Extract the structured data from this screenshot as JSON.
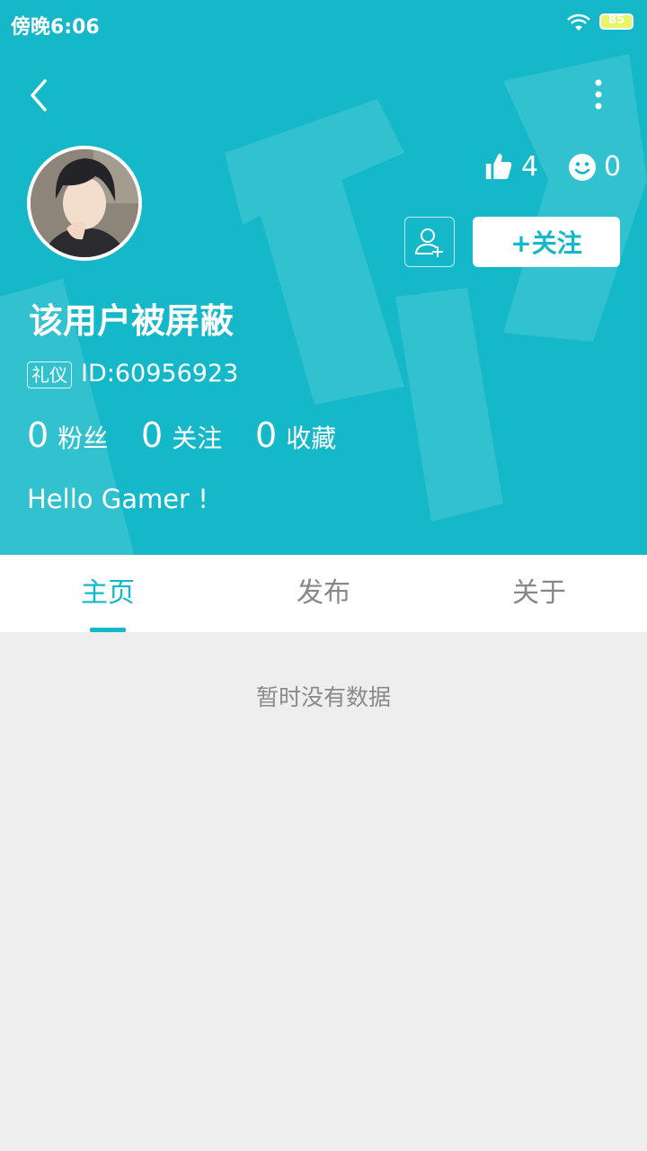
{
  "status_bar": {
    "time": "傍晚6:06",
    "battery": "85"
  },
  "profile": {
    "like_count": "4",
    "smile_count": "0",
    "follow_label": "+关注",
    "name": "该用户被屏蔽",
    "badge": "礼仪",
    "id_text": "ID:60956923",
    "followers": {
      "num": "0",
      "label": "粉丝"
    },
    "following": {
      "num": "0",
      "label": "关注"
    },
    "favorites": {
      "num": "0",
      "label": "收藏"
    },
    "bio": "Hello Gamer !"
  },
  "tabs": [
    {
      "label": "主页"
    },
    {
      "label": "发布"
    },
    {
      "label": "关于"
    }
  ],
  "empty_text": "暂时没有数据",
  "colors": {
    "accent": "#14b8c8",
    "background": "#eeeeee"
  }
}
